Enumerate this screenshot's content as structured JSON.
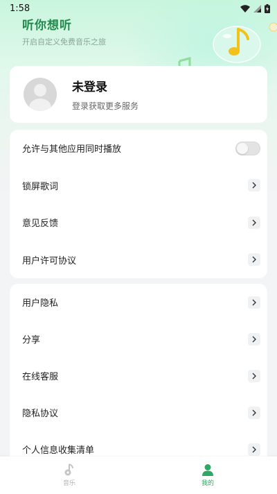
{
  "status_bar": {
    "time": "1:58"
  },
  "header": {
    "title": "听你想听",
    "subtitle": "开启自定义免费音乐之旅"
  },
  "profile": {
    "name": "未登录",
    "subtitle": "登录获取更多服务"
  },
  "menu_group_1": {
    "items": [
      {
        "label": "允许与其他应用同时播放",
        "control": "toggle",
        "enabled": false
      },
      {
        "label": "锁屏歌词",
        "control": "chevron"
      },
      {
        "label": "意见反馈",
        "control": "chevron"
      },
      {
        "label": "用户许可协议",
        "control": "chevron"
      }
    ]
  },
  "menu_group_2": {
    "items": [
      {
        "label": "用户隐私",
        "control": "chevron"
      },
      {
        "label": "分享",
        "control": "chevron"
      },
      {
        "label": "在线客服",
        "control": "chevron"
      },
      {
        "label": "隐私协议",
        "control": "chevron"
      },
      {
        "label": "个人信息收集清单",
        "control": "chevron"
      }
    ]
  },
  "tab_bar": {
    "tabs": [
      {
        "label": "音乐",
        "icon": "music-note-icon",
        "active": false
      },
      {
        "label": "我的",
        "icon": "user-icon",
        "active": true
      }
    ]
  },
  "colors": {
    "accent": "#2ea862",
    "title_green": "#1f8a4c",
    "background": "#f3f4f6"
  }
}
